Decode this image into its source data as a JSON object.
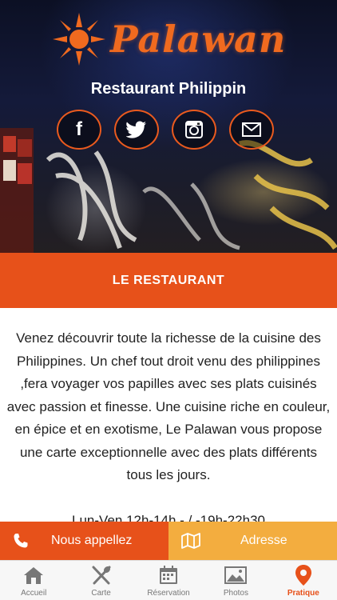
{
  "header": {
    "logo_text": "Palawan",
    "subtitle": "Restaurant Philippin"
  },
  "socials": [
    {
      "icon": "facebook-icon",
      "glyph": "f"
    },
    {
      "icon": "twitter-icon"
    },
    {
      "icon": "instagram-icon"
    },
    {
      "icon": "email-icon"
    }
  ],
  "section": {
    "title": "LE RESTAURANT"
  },
  "content": {
    "description": "Venez découvrir toute la richesse de la cuisine des Philippines. Un chef tout droit venu des philippines ,fera voyager vos papilles avec ses plats cuisinés avec passion et finesse. Une cuisine riche en couleur, en épice et en exotisme, Le Palawan vous propose une carte exceptionnelle avec des plats différents tous les jours.",
    "hours": "Lun-Ven 12h-14h - / -19h-22h30"
  },
  "actions": {
    "call_label": "Nous appellez",
    "address_label": "Adresse"
  },
  "tabs": [
    {
      "label": "Accueil",
      "icon": "home-icon",
      "active": false
    },
    {
      "label": "Carte",
      "icon": "cutlery-icon",
      "active": false
    },
    {
      "label": "Réservation",
      "icon": "calendar-icon",
      "active": false
    },
    {
      "label": "Photos",
      "icon": "photos-icon",
      "active": false
    },
    {
      "label": "Pratique",
      "icon": "location-pin-icon",
      "active": true
    }
  ],
  "colors": {
    "accent": "#e7511a",
    "secondary": "#f3ad3f",
    "tab_inactive": "#777777"
  }
}
